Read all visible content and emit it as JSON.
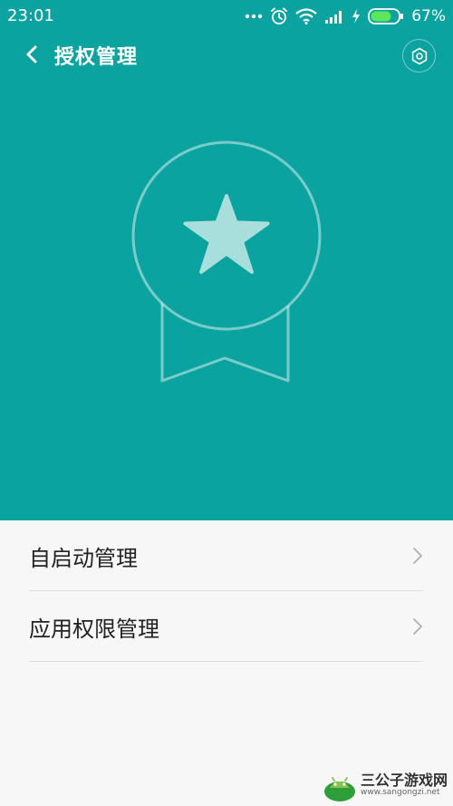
{
  "status_bar": {
    "time": "23:01",
    "battery_percent": "67%",
    "battery_level": 0.67,
    "icons": [
      "dots-icon",
      "alarm-icon",
      "wifi-icon",
      "signal-icon",
      "charging-icon",
      "battery-icon"
    ]
  },
  "header": {
    "title": "授权管理",
    "back_icon": "chevron-left-icon",
    "settings_icon": "gear-icon"
  },
  "hero": {
    "background_color": "#0ba3a0",
    "illustration": "medal-star-icon"
  },
  "menu": {
    "items": [
      {
        "label": "自启动管理",
        "icon": "chevron-right-icon"
      },
      {
        "label": "应用权限管理",
        "icon": "chevron-right-icon"
      }
    ]
  },
  "watermark": {
    "title": "三公子游戏网",
    "url": "www.sangongzi.net"
  }
}
